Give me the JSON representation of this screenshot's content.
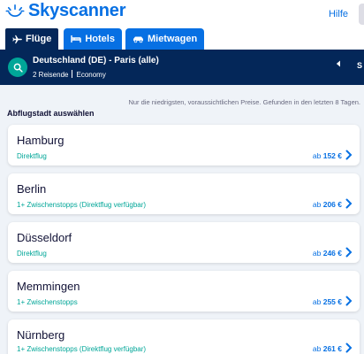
{
  "brand": {
    "name": "Skyscanner",
    "color": "#0770e3"
  },
  "header": {
    "help_label": "Hilfe"
  },
  "tabs": [
    {
      "label": "Flüge",
      "icon": "plane-icon",
      "active": true
    },
    {
      "label": "Hotels",
      "icon": "bed-icon",
      "active": false
    },
    {
      "label": "Mietwagen",
      "icon": "car-icon",
      "active": false
    }
  ],
  "search": {
    "route": "Deutschland (DE) - Paris (alle)",
    "travellers": "2 Reisende",
    "cabin": "Economy",
    "extra": "S"
  },
  "note": "Nur die niedrigsten, voraussichtlichen Preise. Gefunden in den letzten 8 Tagen.",
  "section_title": "Abflugstadt auswählen",
  "results": [
    {
      "city": "Hamburg",
      "stops": "Direktflug",
      "price_prefix": "ab",
      "price": "152 €"
    },
    {
      "city": "Berlin",
      "stops": "1+ Zwischenstopps (Direktflug verfügbar)",
      "price_prefix": "ab",
      "price": "206 €"
    },
    {
      "city": "Düsseldorf",
      "stops": "Direktflug",
      "price_prefix": "ab",
      "price": "246 €"
    },
    {
      "city": "Memmingen",
      "stops": "1+ Zwischenstopps",
      "price_prefix": "ab",
      "price": "255 €"
    },
    {
      "city": "Nürnberg",
      "stops": "1+ Zwischenstopps (Direktflug verfügbar)",
      "price_prefix": "ab",
      "price": "261 €"
    }
  ],
  "colors": {
    "navy": "#042759",
    "teal": "#00a698",
    "link": "#0770e3"
  }
}
